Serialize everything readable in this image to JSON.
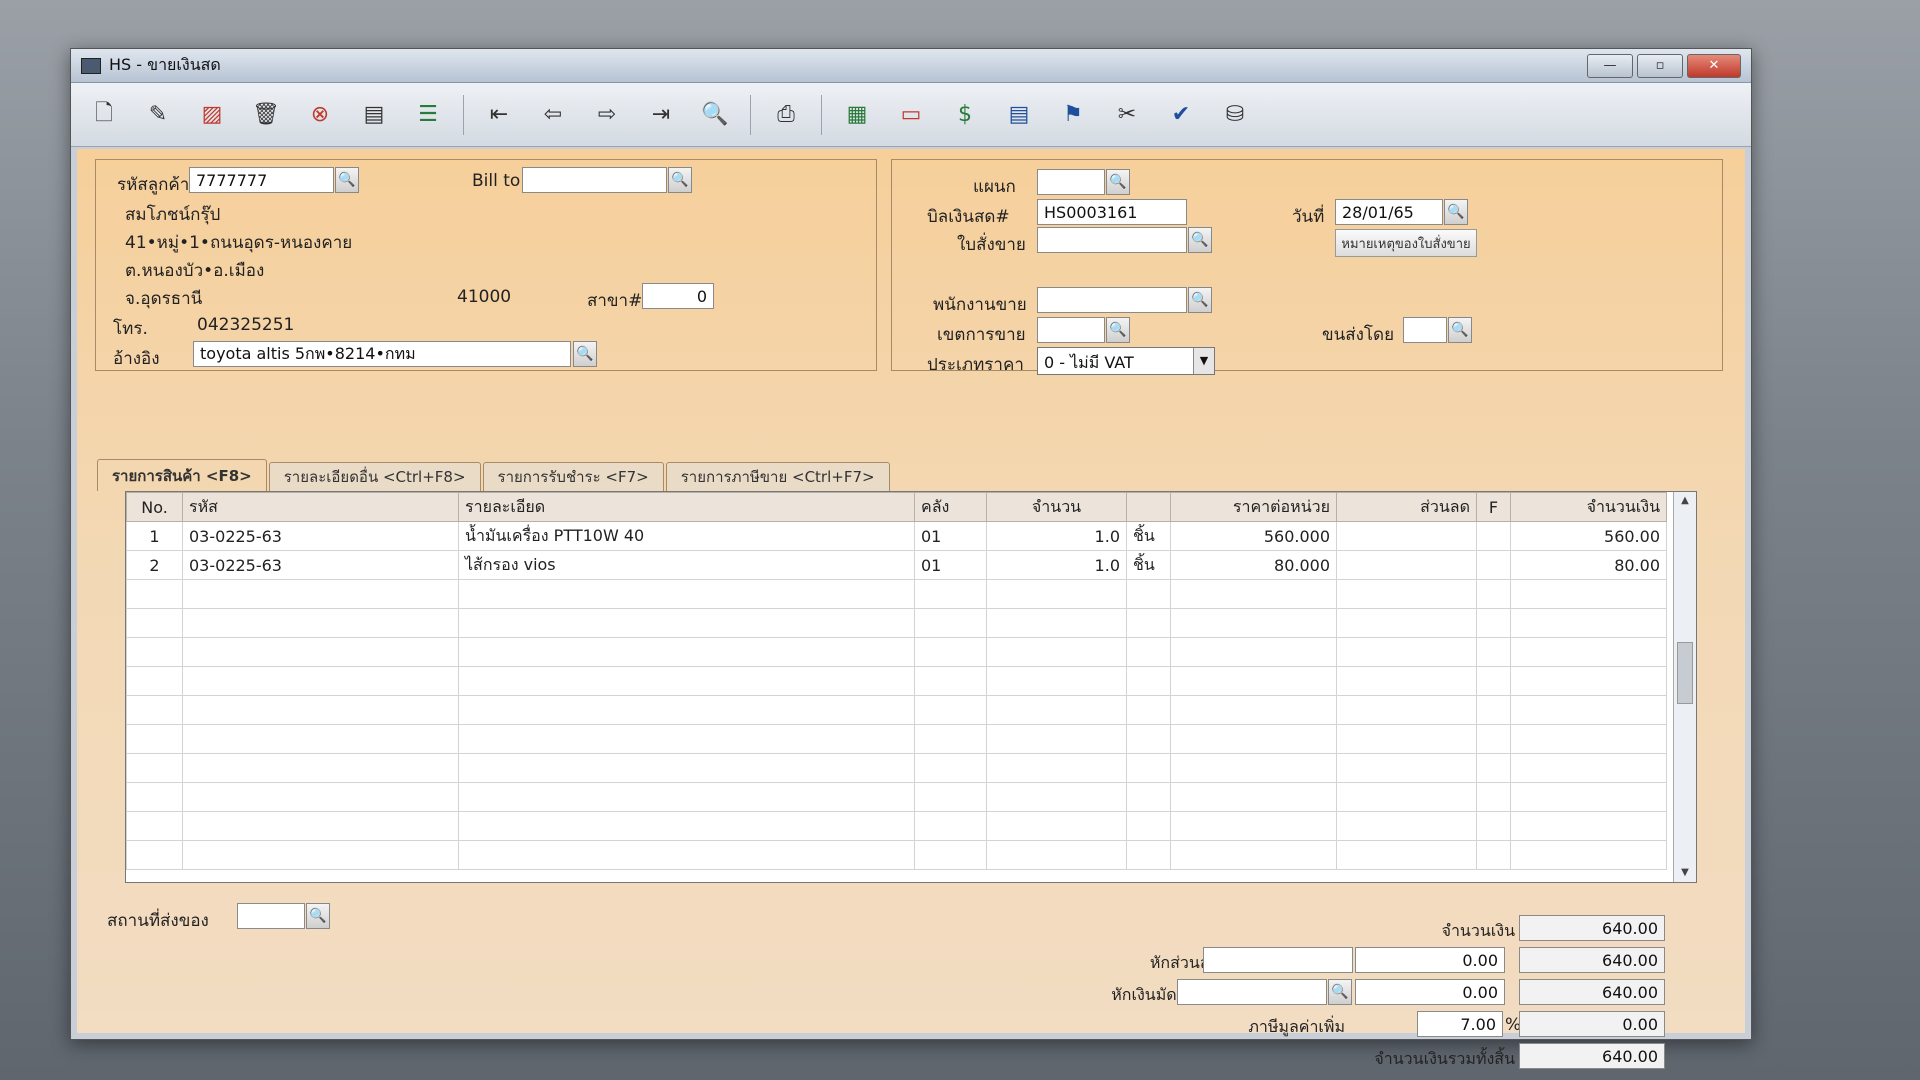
{
  "window": {
    "title": "HS - ขายเงินสด"
  },
  "window_controls": {
    "minimize": "—",
    "maximize": "▫",
    "close": "✕"
  },
  "toolbar": {
    "icons": [
      "new-doc-icon",
      "edit-icon",
      "delete-stamp-icon",
      "trash-icon",
      "cancel-icon",
      "save-icon",
      "books-icon",
      "first-record-icon",
      "prev-record-icon",
      "next-record-icon",
      "last-record-icon",
      "search-doc-icon",
      "print-icon",
      "calculator-icon",
      "card-icon",
      "money-icon",
      "report-icon",
      "post-icon",
      "tools-icon",
      "ok-icon",
      "network-icon"
    ]
  },
  "customer": {
    "code_label": "รหัสลูกค้า",
    "code_value": "7777777",
    "bill_to_label": "Bill to",
    "bill_to_value": "",
    "name": "สมโภชน์กรุ๊ป",
    "address1": "41•หมู่•1•ถนนอุดร-หนองคาย",
    "address2": "ต.หนองบัว•อ.เมือง",
    "address3": "จ.อุดรธานี",
    "postcode": "41000",
    "branch_label": "สาขา#",
    "branch_value": "0",
    "phone_label": "โทร.",
    "phone_value": "042325251",
    "ref_label": "อ้างอิง",
    "ref_value": "toyota altis 5กพ•8214•กทม"
  },
  "doc": {
    "dept_label": "แผนก",
    "dept_value": "",
    "bill_no_label": "บิลเงินสด#",
    "bill_no_value": "HS0003161",
    "date_label": "วันที่",
    "date_value": "28/01/65",
    "so_label": "ใบสั่งขาย",
    "so_value": "",
    "so_note_button": "หมายเหตุของใบสั่งขาย",
    "salesperson_label": "พนักงานขาย",
    "salesperson_value": "",
    "sales_area_label": "เขตการขาย",
    "sales_area_value": "",
    "ship_by_label": "ขนส่งโดย",
    "ship_by_value": "",
    "price_type_label": "ประเภทราคา",
    "price_type_value": "0 - ไม่มี VAT"
  },
  "tabs": [
    "รายการสินค้า <F8>",
    "รายละเอียดอื่น <Ctrl+F8>",
    "รายการรับชำระ <F7>",
    "รายการภาษีขาย <Ctrl+F7>"
  ],
  "grid": {
    "headers": [
      "No.",
      "รหัส",
      "รายละเอียด",
      "คลัง",
      "จำนวน",
      "",
      "ราคาต่อหน่วย",
      "ส่วนลด",
      "F",
      "จำนวนเงิน"
    ],
    "rows": [
      [
        "1",
        "03-0225-63",
        "น้ำมันเครื่อง PTT10W 40",
        "01",
        "1.0",
        "ชิ้น",
        "560.000",
        "",
        "",
        "560.00"
      ],
      [
        "2",
        "03-0225-63",
        "ไส้กรอง vios",
        "01",
        "1.0",
        "ชิ้น",
        "80.000",
        "",
        "",
        "80.00"
      ]
    ]
  },
  "footer": {
    "ship_place_label": "สถานที่ส่งของ",
    "ship_place_value": "",
    "amount_label": "จำนวนเงิน",
    "amount_value": "640.00",
    "discount_label": "หักส่วนลด",
    "discount_code": "",
    "discount_value": "0.00",
    "after_discount": "640.00",
    "deposit_label": "หักเงินมัดจำ",
    "deposit_code": "",
    "deposit_value": "0.00",
    "after_deposit": "640.00",
    "vat_label": "ภาษีมูลค่าเพิ่ม",
    "vat_rate": "7.00",
    "vat_pct": "%",
    "vat_value": "0.00",
    "total_label": "จำนวนเงินรวมทั้งสิ้น",
    "total_value": "640.00"
  }
}
